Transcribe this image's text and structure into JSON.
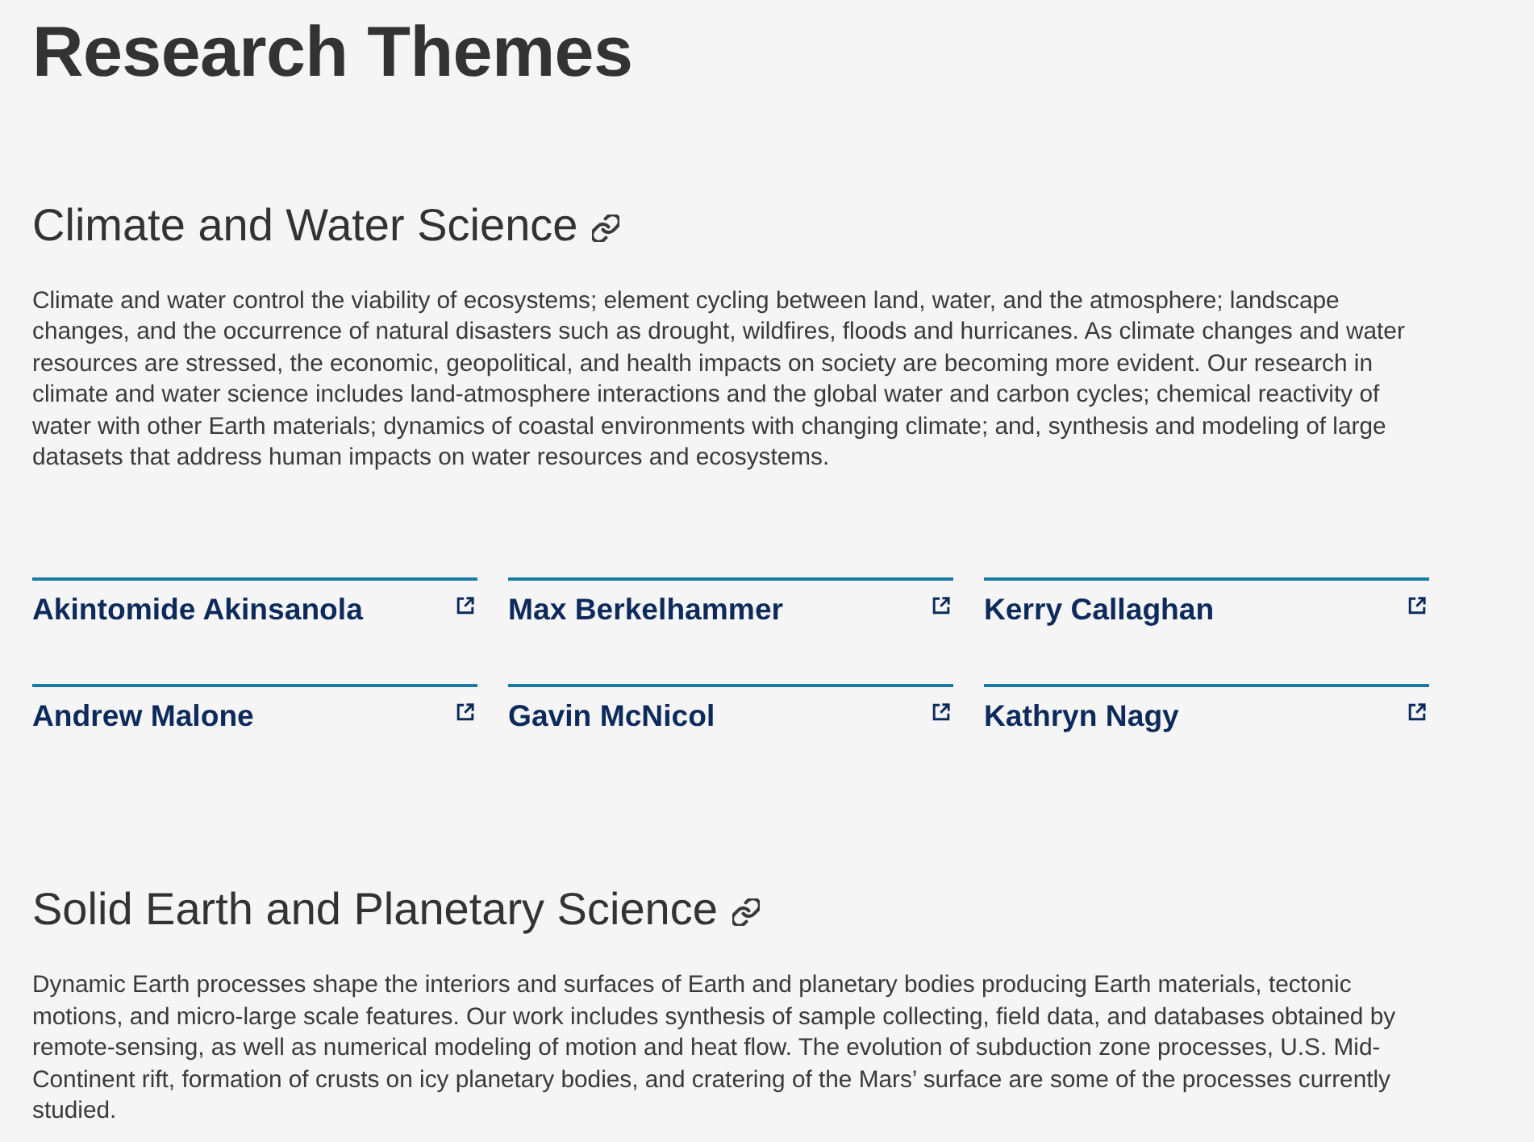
{
  "page_title": "Research Themes",
  "sections": [
    {
      "heading": "Climate and Water Science",
      "description": "Climate and water control the viability of ecosystems; element cycling between land, water, and the atmosphere; landscape changes, and the occurrence of natural disasters such as drought, wildfires, floods and hurricanes. As climate changes and water resources are stressed, the economic, geopolitical, and health impacts on society are becoming more evident. Our research in climate and water science includes land-atmosphere interactions and the global water and carbon cycles; chemical reactivity of water with other Earth materials; dynamics of coastal environments with changing climate; and, synthesis and modeling of large datasets that address human impacts on water resources and ecosystems.",
      "people": [
        "Akintomide Akinsanola",
        "Max Berkelhammer",
        "Kerry Callaghan",
        "Andrew Malone",
        "Gavin McNicol",
        "Kathryn Nagy"
      ]
    },
    {
      "heading": "Solid Earth and Planetary Science",
      "description": "Dynamic Earth processes shape the interiors and surfaces of Earth and planetary bodies producing Earth materials, tectonic motions, and micro-large scale features. Our work includes synthesis of sample collecting, field data, and databases obtained by remote-sensing, as well as numerical modeling of motion and heat flow. The evolution of subduction zone processes, U.S. Mid-Continent rift, formation of crusts on icy planetary bodies, and cratering of the Mars’ surface are some of the processes currently studied."
    }
  ]
}
